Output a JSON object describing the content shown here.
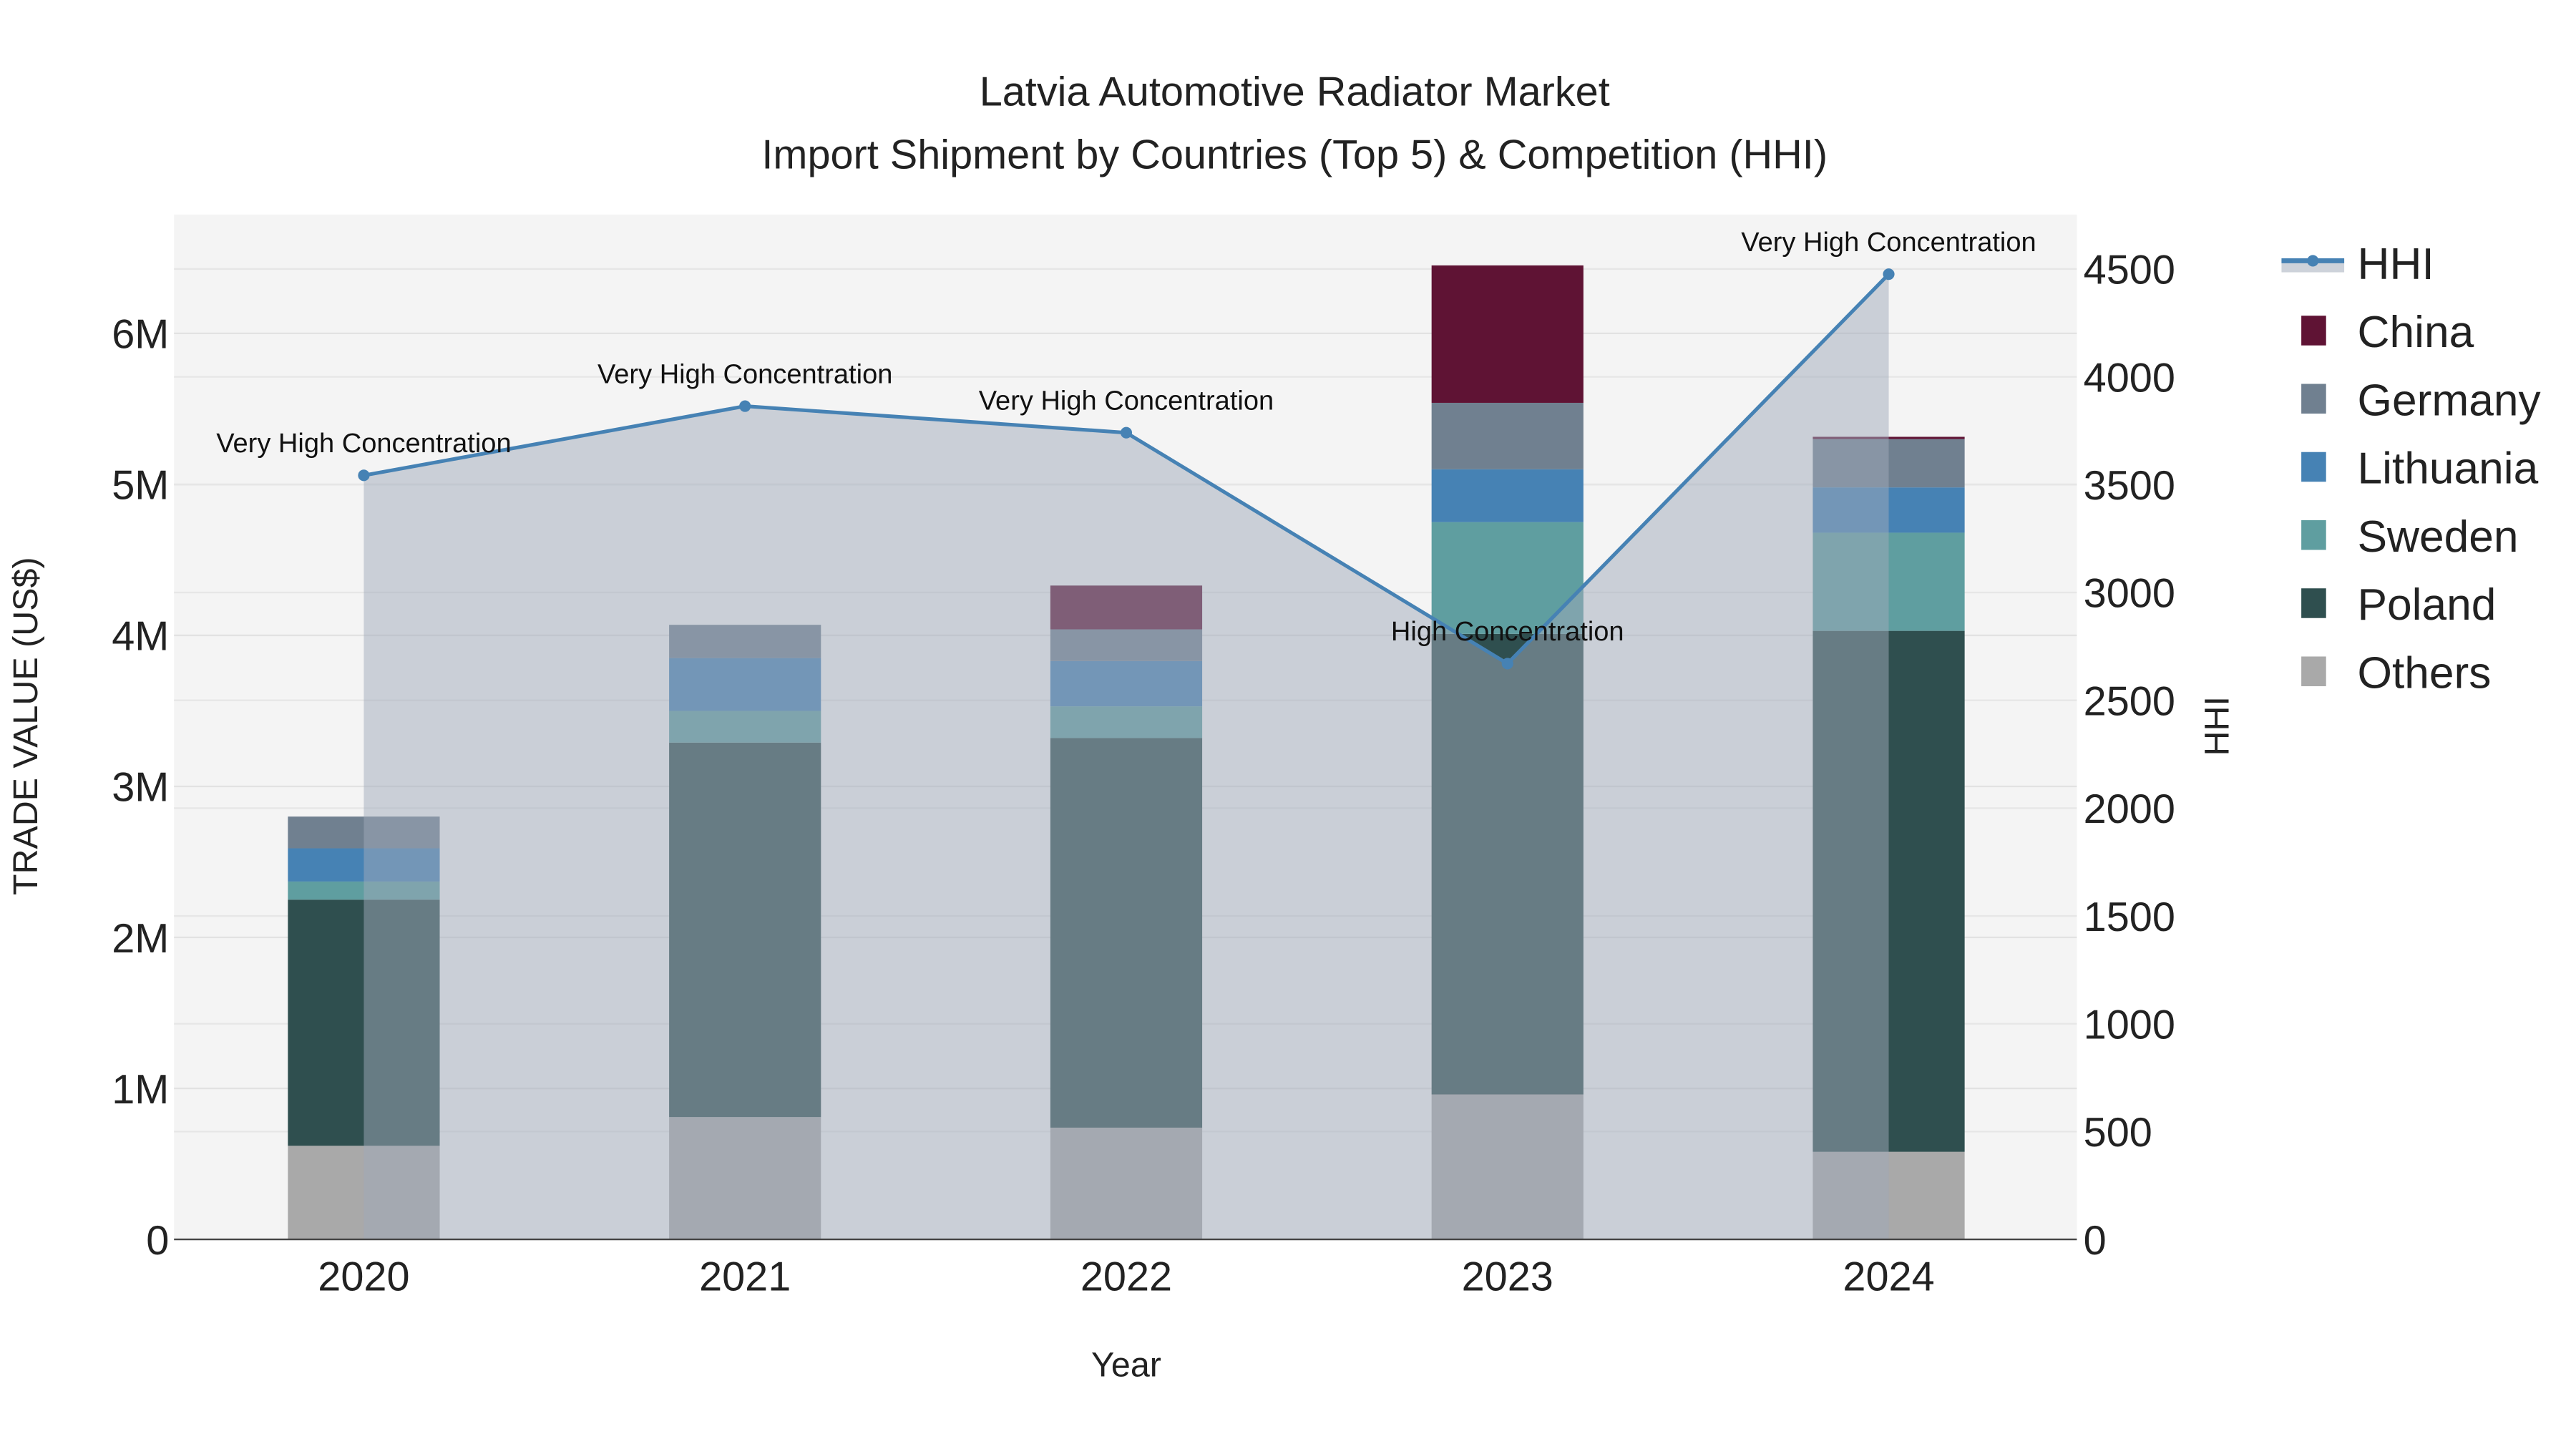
{
  "chart_data": {
    "type": "bar",
    "title": "Latvia Automotive Radiator Market",
    "subtitle": "Import Shipment by Countries (Top 5) & Competition (HHI)",
    "xlabel": "Year",
    "ylabel": "TRADE VALUE (US$)",
    "y2label": "HHI",
    "categories": [
      "2020",
      "2021",
      "2022",
      "2023",
      "2024"
    ],
    "ylim": [
      0,
      6800000
    ],
    "y2lim": [
      0,
      4750
    ],
    "yticks": [
      {
        "v": 0,
        "label": "0"
      },
      {
        "v": 1000000,
        "label": "1M"
      },
      {
        "v": 2000000,
        "label": "2M"
      },
      {
        "v": 3000000,
        "label": "3M"
      },
      {
        "v": 4000000,
        "label": "4M"
      },
      {
        "v": 5000000,
        "label": "5M"
      },
      {
        "v": 6000000,
        "label": "6M"
      }
    ],
    "y2ticks": [
      "0",
      "500",
      "1000",
      "1500",
      "2000",
      "2500",
      "3000",
      "3500",
      "4000",
      "4500"
    ],
    "stacked_series": [
      {
        "name": "Others",
        "color": "#a9a9a9",
        "values": [
          620000,
          810000,
          740000,
          960000,
          580000
        ]
      },
      {
        "name": "Poland",
        "color": "#2f4f4f",
        "values": [
          1630000,
          2480000,
          2580000,
          3050000,
          3450000
        ]
      },
      {
        "name": "Sweden",
        "color": "#5f9ea0",
        "values": [
          120000,
          210000,
          210000,
          740000,
          650000
        ]
      },
      {
        "name": "Lithuania",
        "color": "#4682b4",
        "values": [
          220000,
          350000,
          300000,
          350000,
          300000
        ]
      },
      {
        "name": "Germany",
        "color": "#708090",
        "values": [
          210000,
          220000,
          210000,
          440000,
          320000
        ]
      },
      {
        "name": "China",
        "color": "#5f1334",
        "values": [
          0,
          0,
          290000,
          910000,
          15000
        ]
      }
    ],
    "hhi": {
      "name": "HHI",
      "color": "#4682b4",
      "values": [
        3543,
        3864,
        3741,
        2670,
        4476
      ],
      "annotations": [
        "Very High Concentration",
        "Very High Concentration",
        "Very High Concentration",
        "High Concentration",
        "Very High Concentration"
      ]
    },
    "legend": [
      "HHI",
      "China",
      "Germany",
      "Lithuania",
      "Sweden",
      "Poland",
      "Others"
    ],
    "legend_position": "right",
    "grid": true
  }
}
